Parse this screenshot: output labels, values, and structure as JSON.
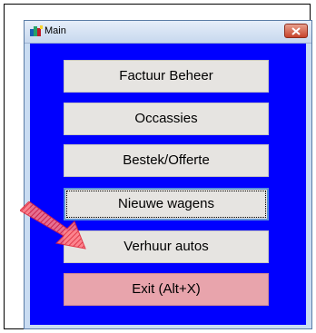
{
  "window": {
    "title": "Main",
    "close_icon": "close-icon"
  },
  "menu": {
    "buttons": [
      {
        "label": "Factuur Beheer"
      },
      {
        "label": "Occassies"
      },
      {
        "label": "Bestek/Offerte"
      },
      {
        "label": "Nieuwe wagens"
      },
      {
        "label": "Verhuur autos"
      },
      {
        "label": "Exit   (Alt+X)"
      }
    ]
  },
  "colors": {
    "client_bg": "#0000ff",
    "button_bg": "#e6e4e1",
    "exit_bg": "#e8a4ac",
    "arrow": "#ff4b5c"
  }
}
